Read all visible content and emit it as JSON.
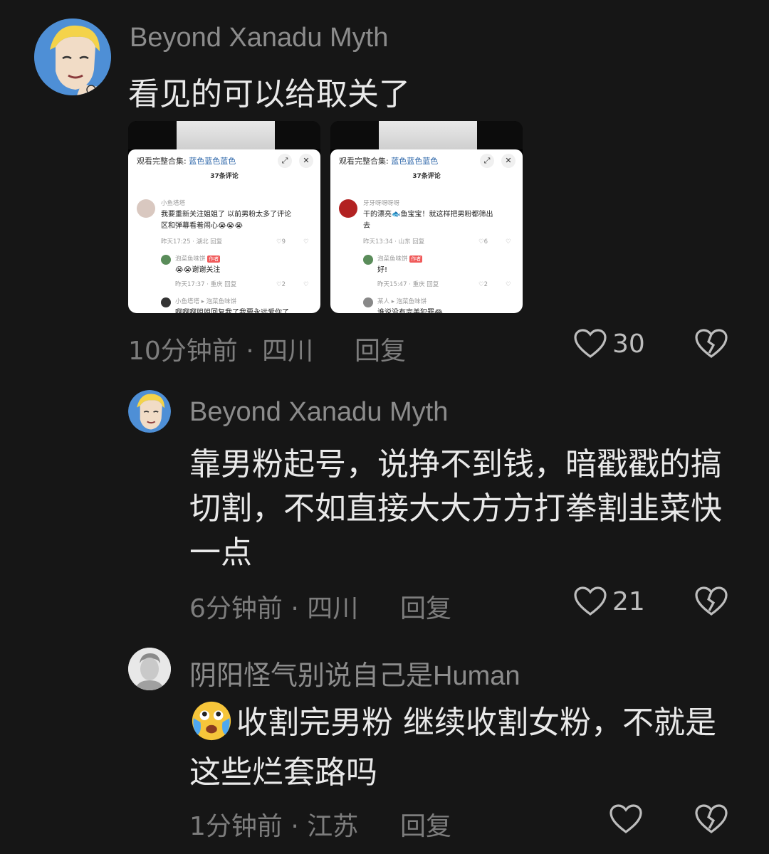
{
  "comments": [
    {
      "username": "Beyond Xanadu Myth",
      "text": "看见的可以给取关了",
      "time_location": "10分钟前 · 四川",
      "reply_label": "回复",
      "likes": "30"
    },
    {
      "username": "Beyond Xanadu Myth",
      "text_line1": "靠男粉起号，说挣不到钱，暗戳戳的搞",
      "text_line2": "切割，不如直接大大方方打拳割韭菜快",
      "text_line3": "一点",
      "time_location": "6分钟前 · 四川",
      "reply_label": "回复",
      "likes": "21"
    },
    {
      "username": "阴阳怪气别说自己是Human",
      "text_line1": "收割完男粉 继续收割女粉，不就是",
      "text_line2": "这些烂套路吗",
      "time_location": "1分钟前 · 江苏",
      "reply_label": "回复",
      "likes": ""
    }
  ],
  "screenshots": [
    {
      "header_prefix": "观看完整合集: ",
      "header_link": "蓝色蓝色蓝色",
      "count": "37条评论",
      "c1_user": "小鱼塔塔",
      "c1_line1": "我要重新关注姐姐了 以前男粉太多了评论",
      "c1_line2": "区和弹幕看着闹心😭😭😭",
      "c1_meta": "昨天17:25 · 湖北   回复",
      "c1_likes": "9",
      "r1_user": "泡菜鱼味饼",
      "r1_badge": "作者",
      "r1_text": "😭😭谢谢关注",
      "r1_meta": "昨天17:37 · 重庆   回复",
      "r1_likes": "2",
      "r2_user": "小鱼塔塔 ▸ 泡菜鱼味饼",
      "r2_text": "啊啊啊姐姐回复我了我要永远爱你了"
    },
    {
      "header_prefix": "观看完整合集: ",
      "header_link": "蓝色蓝色蓝色",
      "count": "37条评论",
      "c1_user": "牙牙呀呀呀呀",
      "c1_line1": "干的漂亮🐟鱼宝宝！就这样把男粉都筛出",
      "c1_line2": "去",
      "c1_meta": "昨天13:34 · 山东   回复",
      "c1_likes": "6",
      "r1_user": "泡菜鱼味饼",
      "r1_badge": "作者",
      "r1_text": "好!",
      "r1_meta": "昨天15:47 · 重庆   回复",
      "r1_likes": "2",
      "r2_user": "某人 ▸ 泡菜鱼味饼",
      "r2_text": "谁说没有完美犯罪😂"
    }
  ],
  "colors": {
    "background": "#161616",
    "username": "#8c8c8c",
    "body_text": "#e9e9e9",
    "meta": "#7d7d7d"
  },
  "icons": [
    "heart-icon",
    "dislike-icon",
    "crying-emoji"
  ]
}
